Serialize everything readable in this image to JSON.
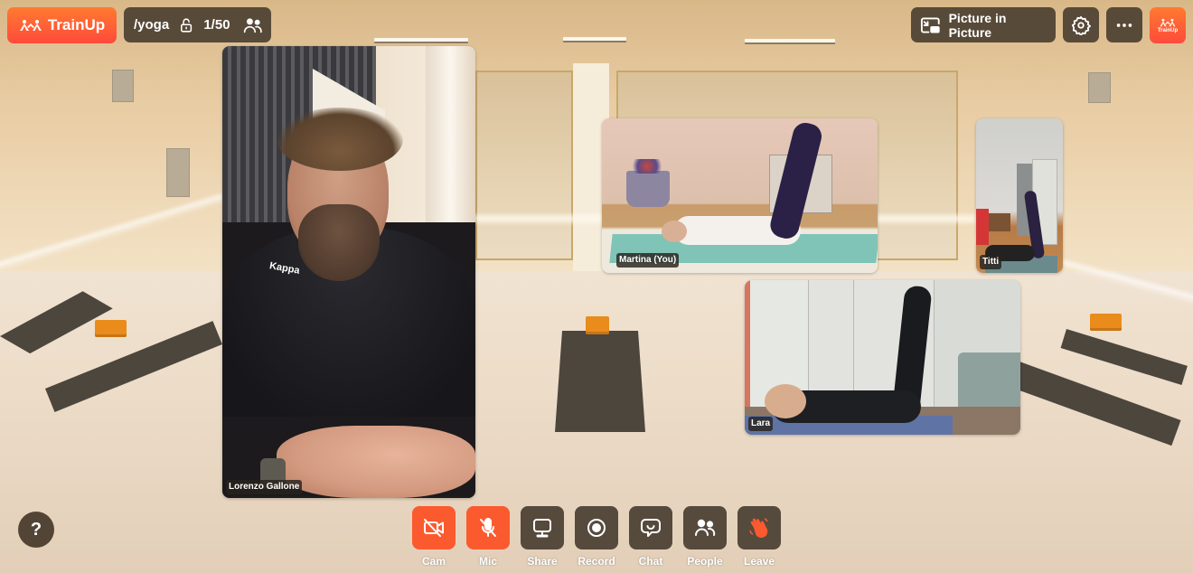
{
  "header": {
    "brand": {
      "name": "TrainUp",
      "icon": "kappa-logo-icon",
      "color": "#ff5a36"
    },
    "room": {
      "name": "/yoga",
      "lock_icon": "unlock-icon",
      "participants": "1/50",
      "people_icon": "people-icon"
    },
    "pip_label": "Picture in Picture",
    "settings_icon": "gear-icon",
    "more_icon": "more-horizontal-icon",
    "avatar": {
      "label": "TrainUp"
    }
  },
  "participants": [
    {
      "name": "Lorenzo Gallone",
      "shirt_text": "Kappa"
    },
    {
      "name": "Martina (You)"
    },
    {
      "name": "Titti"
    },
    {
      "name": "Lara"
    }
  ],
  "help": {
    "label": "?"
  },
  "controls": [
    {
      "label": "Cam",
      "icon": "camera-off-icon",
      "active": true
    },
    {
      "label": "Mic",
      "icon": "mic-off-icon",
      "active": true
    },
    {
      "label": "Share",
      "icon": "monitor-icon",
      "active": false
    },
    {
      "label": "Record",
      "icon": "record-icon",
      "active": false
    },
    {
      "label": "Chat",
      "icon": "chat-icon",
      "active": false
    },
    {
      "label": "People",
      "icon": "people-icon",
      "active": false
    },
    {
      "label": "Leave",
      "icon": "wave-hand-icon",
      "active": false
    }
  ],
  "colors": {
    "accent": "#fb5a2f",
    "control_bg": "#564a3d",
    "pill_bg": "#463a2c"
  }
}
